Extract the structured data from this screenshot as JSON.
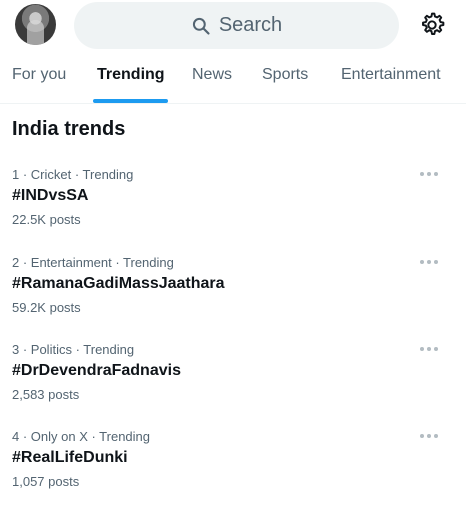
{
  "header": {
    "search_placeholder": "Search"
  },
  "tabs": [
    {
      "label": "For you"
    },
    {
      "label": "Trending"
    },
    {
      "label": "News"
    },
    {
      "label": "Sports"
    },
    {
      "label": "Entertainment"
    }
  ],
  "active_tab": "Trending",
  "section": {
    "title": "India trends"
  },
  "trends": [
    {
      "rank": "1",
      "category": "Cricket",
      "status": "Trending",
      "meta": "1 · Cricket · Trending",
      "tag": "#INDvsSA",
      "posts": "22.5K posts"
    },
    {
      "rank": "2",
      "category": "Entertainment",
      "status": "Trending",
      "meta": "2 · Entertainment · Trending",
      "tag": "#RamanaGadiMassJaathara",
      "posts": "59.2K posts"
    },
    {
      "rank": "3",
      "category": "Politics",
      "status": "Trending",
      "meta": "3 · Politics · Trending",
      "tag": "#DrDevendraFadnavis",
      "posts": "2,583 posts"
    },
    {
      "rank": "4",
      "category": "Only on X",
      "status": "Trending",
      "meta": "4 · Only on X · Trending",
      "tag": "#RealLifeDunki",
      "posts": "1,057 posts"
    }
  ],
  "icons": {
    "search": "search-icon",
    "settings": "gear-icon",
    "more": "more-dots-icon",
    "avatar": "avatar"
  },
  "colors": {
    "accent": "#1d9bf0",
    "text_primary": "#0f1419",
    "text_secondary": "#536471",
    "search_bg": "#eff3f4"
  }
}
